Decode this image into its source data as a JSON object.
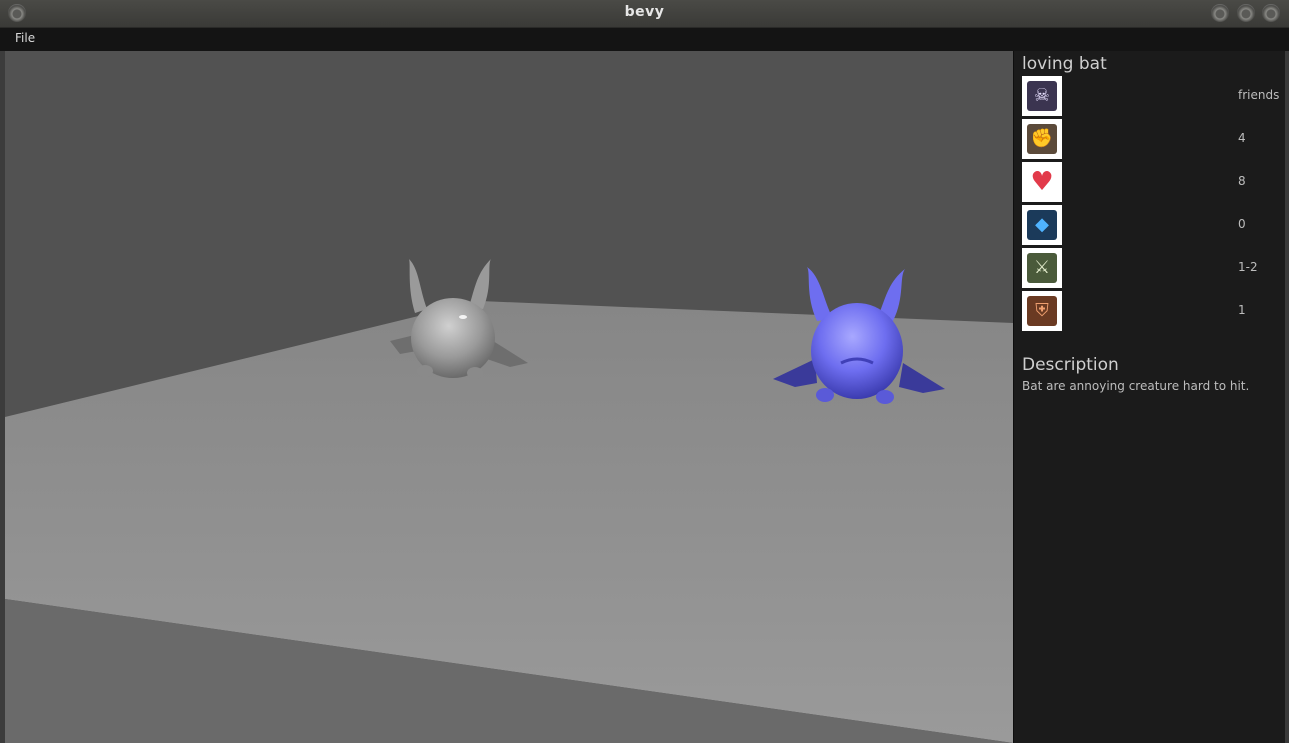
{
  "window": {
    "title": "bevy"
  },
  "menubar": {
    "file_label": "File"
  },
  "creature": {
    "name": "loving bat",
    "stats": [
      {
        "icon": "pirate-skull-icon",
        "value": "friends",
        "accent": "#3b3450"
      },
      {
        "icon": "fist-icon",
        "value": "4",
        "accent": "#5b4a3a"
      },
      {
        "icon": "heart-icon",
        "value": "8",
        "accent": "#e23a4a"
      },
      {
        "icon": "blue-crystal-icon",
        "value": "0",
        "accent": "#2a8ad0"
      },
      {
        "icon": "crossed-swords-icon",
        "value": "1-2",
        "accent": "#4a5a3a"
      },
      {
        "icon": "shield-icon",
        "value": "1",
        "accent": "#b5552a"
      }
    ]
  },
  "description": {
    "title": "Description",
    "text": "Bat are annoying creature hard to hit."
  },
  "scene": {
    "colors": {
      "wall": "#525252",
      "floor": "#8c8c8c",
      "near_edge": "#6a6a6a",
      "bat_grey": "#9a9a9a",
      "bat_blue": "#6e6ef0"
    }
  }
}
